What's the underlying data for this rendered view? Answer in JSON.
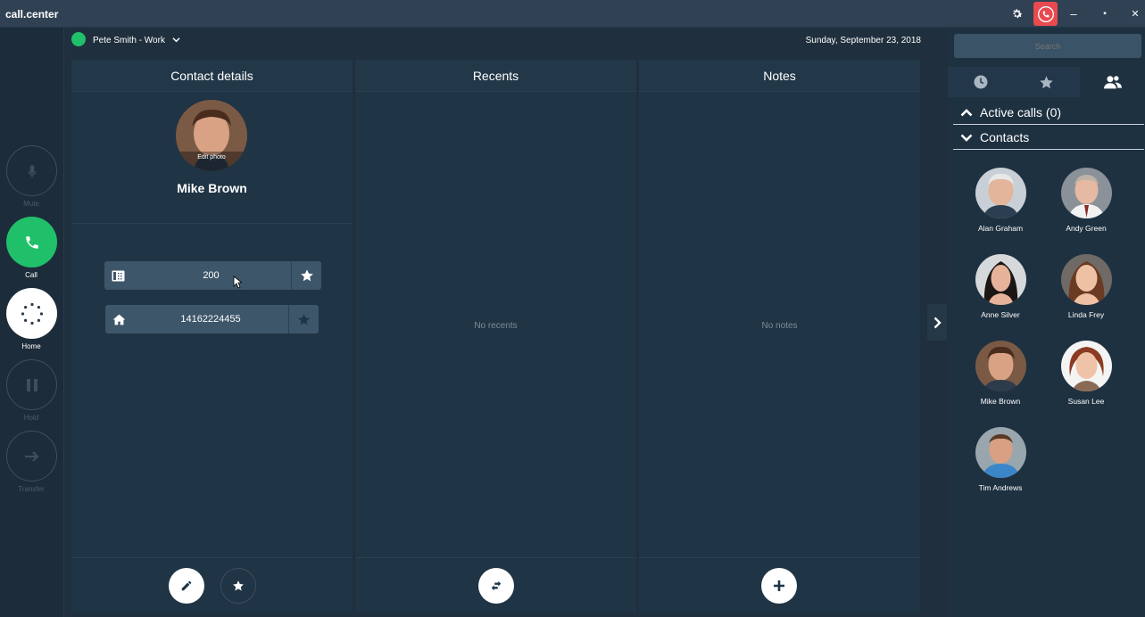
{
  "app": {
    "title": "call.center"
  },
  "window_controls": {
    "settings_icon": "gear-icon",
    "minimize": "–",
    "restore": "▪",
    "close": "✕"
  },
  "status": {
    "user": "Pete Smith - Work",
    "date": "Sunday, September 23, 2018",
    "color": "#20c06a"
  },
  "rail": {
    "mute": "Mute",
    "call": "Call",
    "home": "Home",
    "hold": "Hold",
    "transfer": "Transfer"
  },
  "contact_details": {
    "heading": "Contact details",
    "edit_photo": "Edit photo",
    "name": "Mike Brown",
    "phones": [
      {
        "type": "extension",
        "icon": "extension-icon",
        "number": "200"
      },
      {
        "type": "home",
        "icon": "home-icon",
        "number": "14162224455"
      }
    ]
  },
  "recents": {
    "heading": "Recents",
    "empty": "No recents"
  },
  "notes": {
    "heading": "Notes",
    "empty": "No notes"
  },
  "sidebar": {
    "search_placeholder": "Search",
    "active_calls": "Active calls (0)",
    "contacts_heading": "Contacts",
    "contacts": [
      {
        "name": "Alan Graham"
      },
      {
        "name": "Andy Green"
      },
      {
        "name": "Anne Silver"
      },
      {
        "name": "Linda Frey"
      },
      {
        "name": "Mike Brown"
      },
      {
        "name": "Susan Lee"
      },
      {
        "name": "Tim Andrews"
      }
    ]
  },
  "colors": {
    "accent_green": "#20c06a",
    "danger_red": "#e84a4f",
    "panel": "#1f3444"
  }
}
